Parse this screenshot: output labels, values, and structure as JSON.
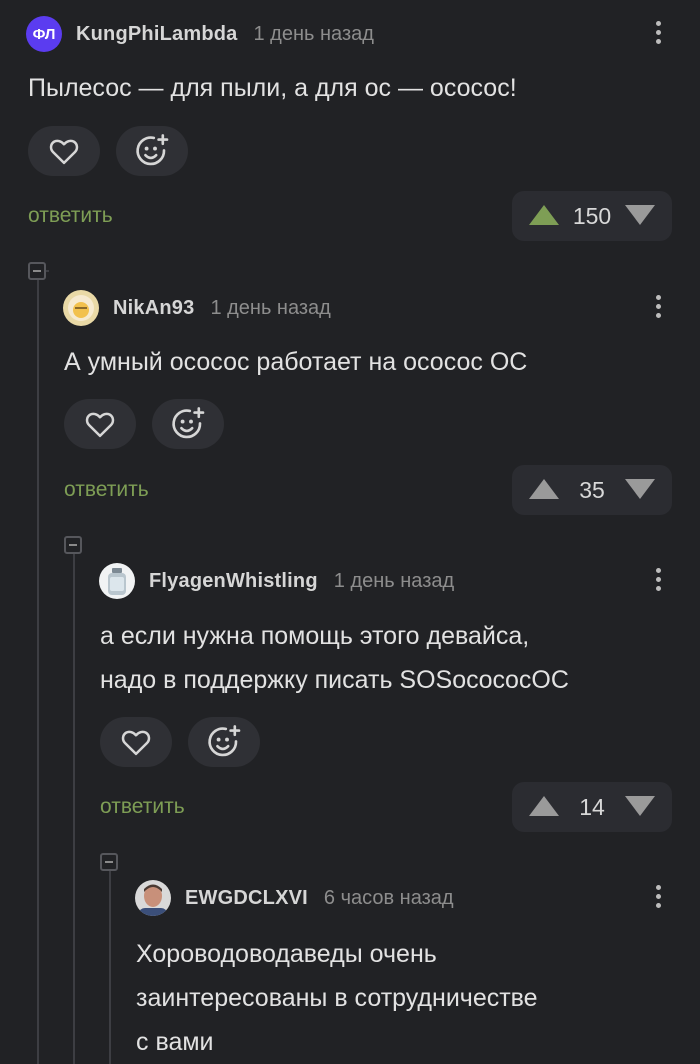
{
  "comments": [
    {
      "avatar_text": "ФЛ",
      "author": "KungPhiLambda",
      "time": "1 день назад",
      "text": "Пылесос — для пыли, а для ос — ососос!",
      "reply_label": "ответить",
      "votes": "150",
      "upvoted": true
    },
    {
      "author": "NikAn93",
      "time": "1 день назад",
      "text": "А умный ососос работает на ососос ОС",
      "reply_label": "ответить",
      "votes": "35",
      "upvoted": false
    },
    {
      "author": "FlyagenWhistling",
      "time": "1 день назад",
      "text_line1": "а если нужна помощь этого девайса,",
      "text_line2": "надо в поддержку писать SOSocococOC",
      "reply_label": "ответить",
      "votes": "14",
      "upvoted": false
    },
    {
      "author": "EWGDCLXVI",
      "time": "6 часов назад",
      "text_line1": "Хороводоводаведы очень",
      "text_line2": "заинтересованы в сотрудничестве",
      "text_line3": "с вами"
    }
  ],
  "colors": {
    "background": "#212225",
    "reply": "#7e9e55",
    "upvote_active": "#7e9e55",
    "upvote_inactive": "#9a9a9a",
    "avatar_brand": "#5b3cf0"
  }
}
